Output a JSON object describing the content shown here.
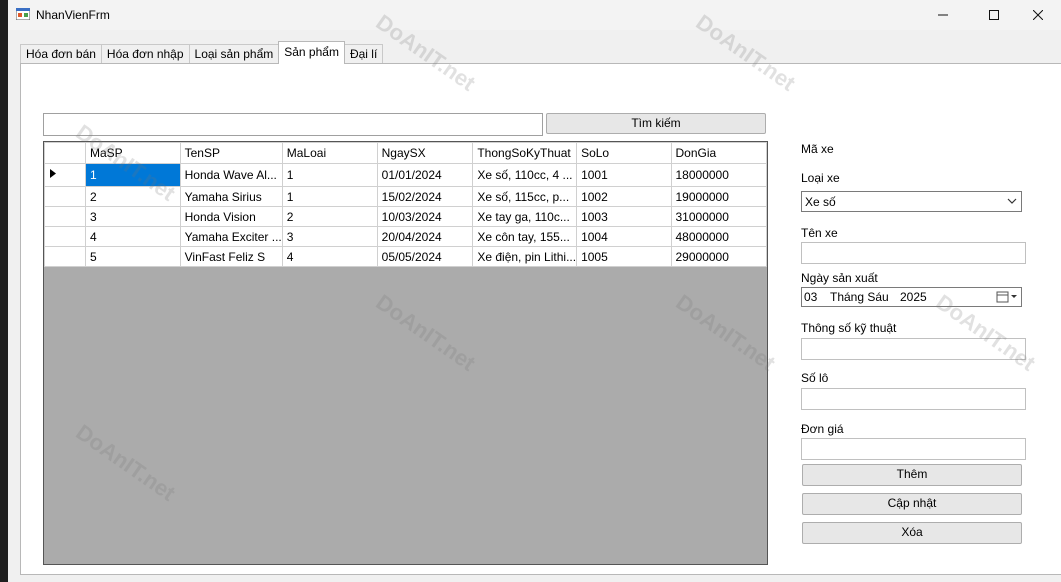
{
  "window": {
    "title": "NhanVienFrm"
  },
  "tabs": [
    {
      "label": "Hóa đơn bán"
    },
    {
      "label": "Hóa đơn nhập"
    },
    {
      "label": "Loại sản phẩm"
    },
    {
      "label": "Sản phẩm"
    },
    {
      "label": "Đại lí"
    }
  ],
  "active_tab": "Sản phẩm",
  "search": {
    "value": "",
    "button_label": "Tìm kiếm"
  },
  "grid": {
    "columns": [
      "MaSP",
      "TenSP",
      "MaLoai",
      "NgaySX",
      "ThongSoKyThuat",
      "SoLo",
      "DonGia"
    ],
    "rows": [
      [
        "1",
        "Honda Wave Al...",
        "1",
        "01/01/2024",
        "Xe số, 110cc, 4 ...",
        "1001",
        "18000000"
      ],
      [
        "2",
        "Yamaha Sirius",
        "1",
        "15/02/2024",
        "Xe số, 115cc, p...",
        "1002",
        "19000000"
      ],
      [
        "3",
        "Honda Vision",
        "2",
        "10/03/2024",
        "Xe tay ga, 110c...",
        "1003",
        "31000000"
      ],
      [
        "4",
        "Yamaha Exciter ...",
        "3",
        "20/04/2024",
        "Xe côn tay, 155...",
        "1004",
        "48000000"
      ],
      [
        "5",
        "VinFast Feliz S",
        "4",
        "05/05/2024",
        "Xe điện, pin Lithi...",
        "1005",
        "29000000"
      ]
    ]
  },
  "form": {
    "ma_xe_label": "Mã xe",
    "loai_xe_label": "Loại xe",
    "loai_xe_value": "Xe số",
    "ten_xe_label": "Tên xe",
    "ngay_sx_label": "Ngày sản xuất",
    "ngay_sx_day": "03",
    "ngay_sx_month": "Tháng Sáu",
    "ngay_sx_year": "2025",
    "thong_so_label": "Thông số kỹ thuật",
    "so_lo_label": "Số lô",
    "don_gia_label": "Đơn giá"
  },
  "buttons": {
    "them": "Thêm",
    "cap_nhat": "Cập nhật",
    "xoa": "Xóa"
  },
  "watermark": {
    "text": "DoAnIT.net"
  }
}
